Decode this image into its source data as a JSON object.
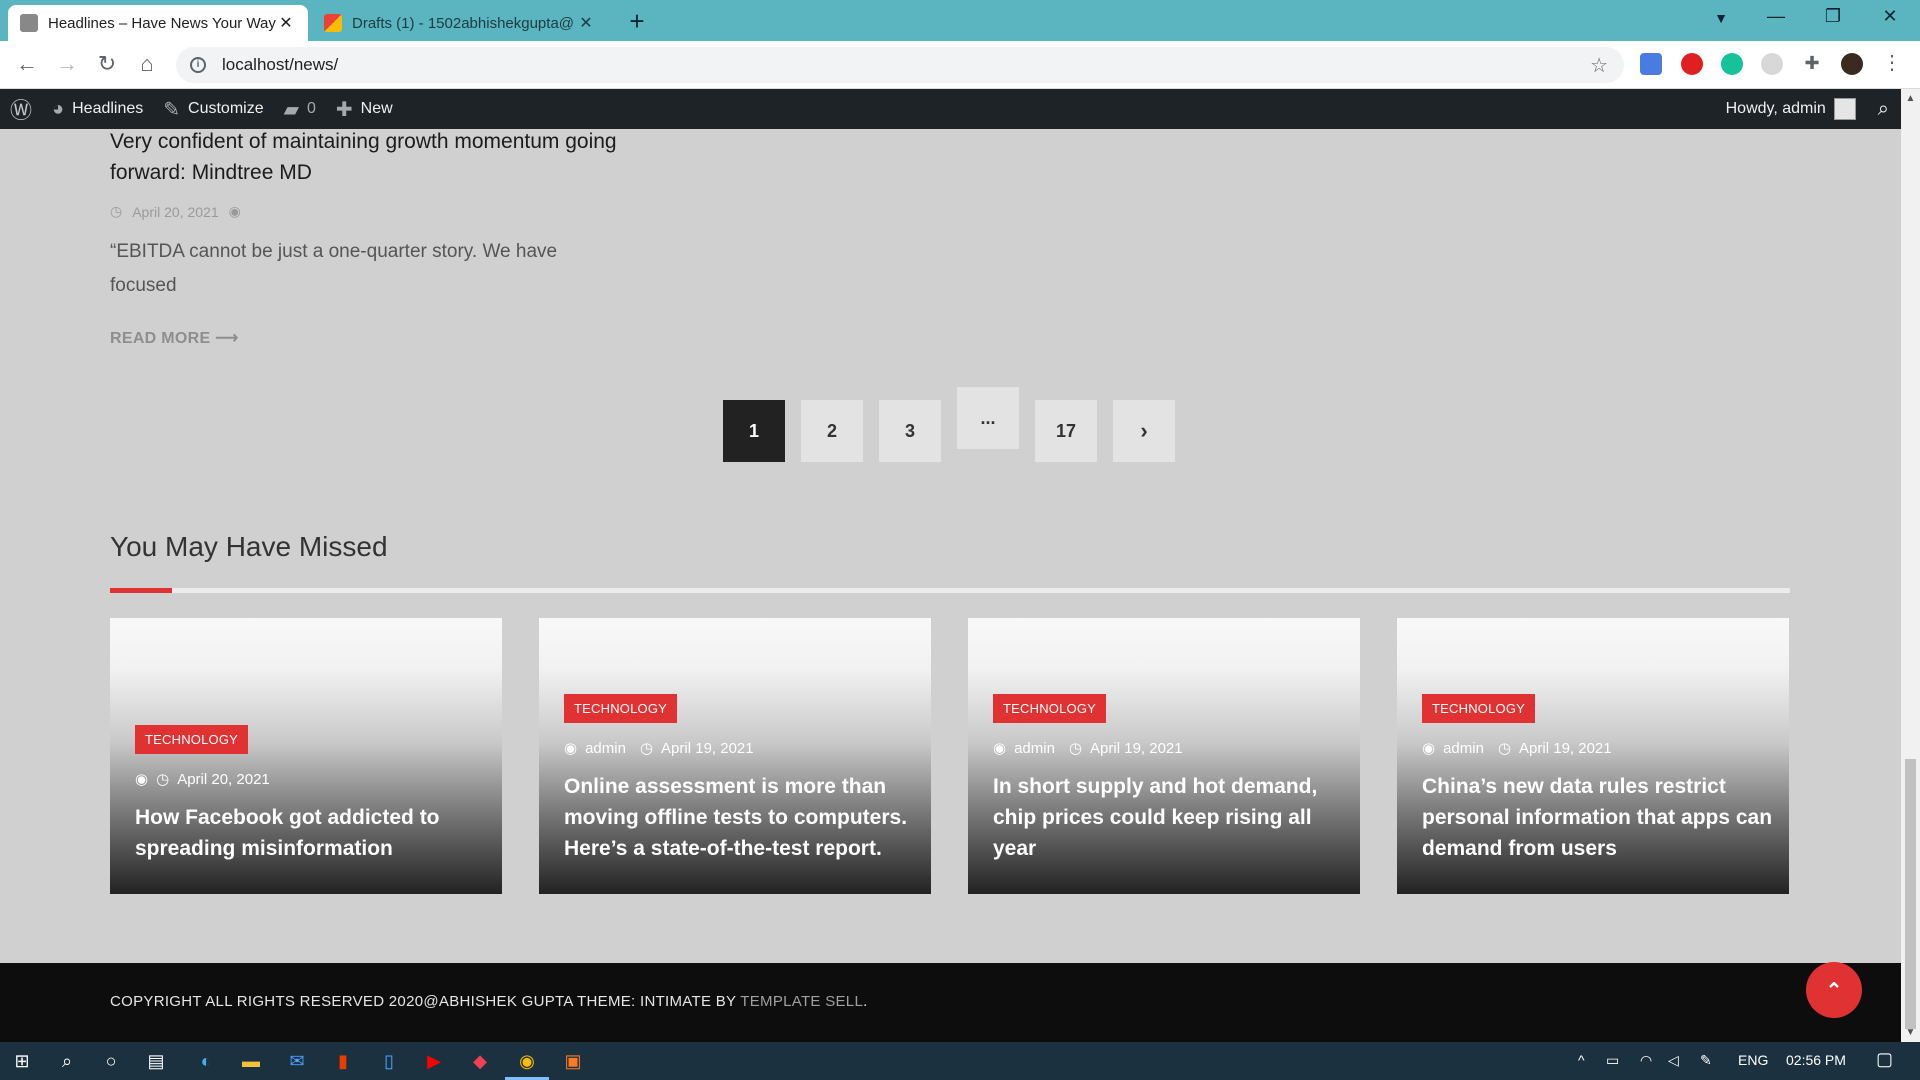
{
  "browser": {
    "tabs": [
      {
        "title": "Headlines – Have News Your Way",
        "close": "✕"
      },
      {
        "title": "Drafts (1) - 1502abhishekgupta@",
        "close": "✕"
      }
    ],
    "new_tab": "+",
    "url": "localhost/news/",
    "window_controls": {
      "minimize": "—",
      "restore": "❐",
      "close": "✕"
    }
  },
  "adminbar": {
    "site_name": "Headlines",
    "customize": "Customize",
    "comments_count": "0",
    "new": "New",
    "howdy": "Howdy, admin"
  },
  "article": {
    "title": "Very confident of maintaining growth momentum going forward: Mindtree MD",
    "date": "April 20, 2021",
    "excerpt": "“EBITDA cannot be just a one-quarter story. We have focused",
    "read_more": "READ MORE ⟶"
  },
  "pagination": {
    "pages": [
      "1",
      "2",
      "3",
      "...",
      "17"
    ],
    "next": "›",
    "current": "1"
  },
  "missed": {
    "heading": "You May Have Missed",
    "cards": [
      {
        "category": "TECHNOLOGY",
        "author": "",
        "date": "April 20, 2021",
        "title": "How Facebook got addicted to spreading misinformation"
      },
      {
        "category": "TECHNOLOGY",
        "author": "admin",
        "date": "April 19, 2021",
        "title": "Online assessment is more than moving offline tests to computers. Here’s a state-of-the-test report."
      },
      {
        "category": "TECHNOLOGY",
        "author": "admin",
        "date": "April 19, 2021",
        "title": "In short supply and hot demand, chip prices could keep rising all year"
      },
      {
        "category": "TECHNOLOGY",
        "author": "admin",
        "date": "April 19, 2021",
        "title": "China’s new data rules restrict personal information that apps can demand from users"
      }
    ]
  },
  "footer": {
    "copyright": "COPYRIGHT ALL RIGHTS RESERVED 2020@ABHISHEK GUPTA THEME: INTIMATE BY ",
    "link": "TEMPLATE SELL",
    "period": ".",
    "to_top": "⌃"
  },
  "taskbar": {
    "language": "ENG",
    "time": "02:56 PM"
  },
  "colors": {
    "accent": "#e03232",
    "browser_tabbar": "#5ab5c0",
    "adminbar": "#1d2327",
    "footer": "#0d0d0d"
  }
}
